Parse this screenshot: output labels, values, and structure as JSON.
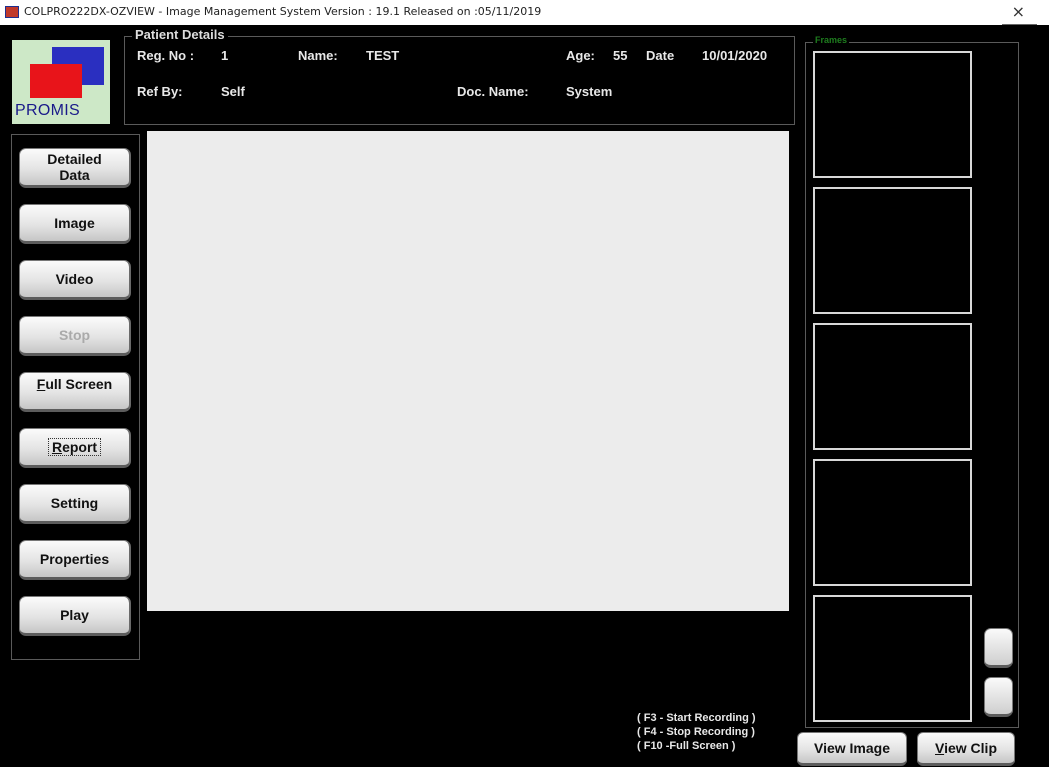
{
  "window": {
    "title": "COLPRO222DX-OZVIEW  - Image Management System Version : 19.1 Released on :05/11/2019",
    "close_glyph": "×"
  },
  "logo": {
    "text": "PROMIS",
    "colors": {
      "background": "#cde8c7",
      "blue": "#2a2fc0",
      "red": "#e8141a"
    }
  },
  "patient": {
    "legend": "Patient Details",
    "reg_label": "Reg. No :",
    "reg_value": "1",
    "name_label": "Name:",
    "name_value": "TEST",
    "age_label": "Age:",
    "age_value": "55",
    "date_label": "Date",
    "date_value": "10/01/2020",
    "refby_label": "Ref By:",
    "refby_value": "Self",
    "doc_label": "Doc. Name:",
    "doc_value": "System"
  },
  "sidebar": {
    "buttons": [
      {
        "first": "Detailed",
        "rest": "Data",
        "enabled": true
      },
      {
        "first": "",
        "rest": "Image",
        "enabled": true
      },
      {
        "first": "",
        "rest": "Video",
        "enabled": true
      },
      {
        "first": "",
        "rest": "Stop",
        "enabled": false
      },
      {
        "first": "F",
        "rest": "ull Screen",
        "enabled": true
      },
      {
        "first": "R",
        "rest": "eport",
        "enabled": true
      },
      {
        "first": "",
        "rest": "Setting",
        "enabled": true
      },
      {
        "first": "",
        "rest": "Properties",
        "enabled": true
      },
      {
        "first": "",
        "rest": "Play",
        "enabled": true
      }
    ]
  },
  "hotkeys": [
    "( F3 - Start Recording )",
    "( F4 - Stop Recording )",
    "( F10 -Full Screen )"
  ],
  "frames": {
    "legend": "Frames",
    "count": 5
  },
  "bottom_buttons": {
    "view_image": "View Image",
    "view_clip_first": "V",
    "view_clip_rest": "iew Clip"
  },
  "colors": {
    "background": "#000000",
    "viewer": "#ececec",
    "frames_legend": "#1e7d1e"
  },
  "icons": {
    "app": "app-icon",
    "close": "close-icon"
  }
}
